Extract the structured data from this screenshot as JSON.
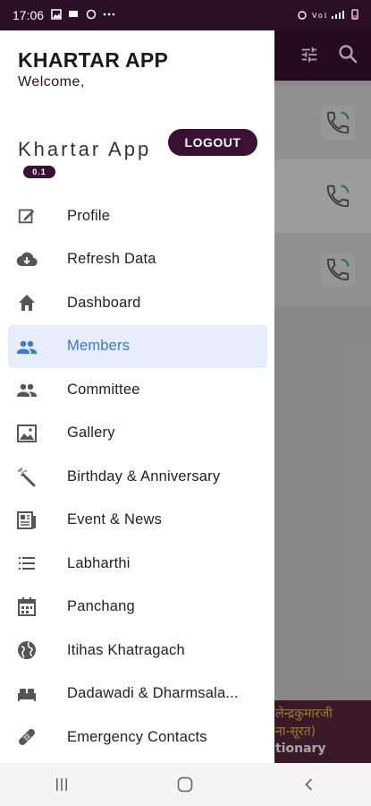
{
  "status_bar": {
    "time": "17:06",
    "left_icons": [
      "image-icon",
      "message-icon",
      "notification-icon",
      "more-dots-icon"
    ],
    "right_icons": [
      "alarm-icon",
      "volte-icon",
      "signal-icon",
      "battery-icon"
    ],
    "more": "···"
  },
  "drawer": {
    "app_title": "KHARTAR APP",
    "welcome": "Welcome,",
    "brand_name": "Khartar App",
    "logout_label": "LOGOUT",
    "version": "0.1",
    "menu": [
      {
        "label": "Profile",
        "icon": "edit-icon",
        "active": false
      },
      {
        "label": "Refresh Data",
        "icon": "cloud-download-icon",
        "active": false
      },
      {
        "label": "Dashboard",
        "icon": "home-icon",
        "active": false
      },
      {
        "label": "Members",
        "icon": "people-icon",
        "active": true
      },
      {
        "label": "Committee",
        "icon": "group-icon",
        "active": false
      },
      {
        "label": "Gallery",
        "icon": "gallery-icon",
        "active": false
      },
      {
        "label": "Birthday & Anniversary",
        "icon": "magic-wand-icon",
        "active": false
      },
      {
        "label": "Event & News",
        "icon": "news-icon",
        "active": false
      },
      {
        "label": "Labharthi",
        "icon": "list-icon",
        "active": false
      },
      {
        "label": "Panchang",
        "icon": "calendar-icon",
        "active": false
      },
      {
        "label": "Itihas Khatragach",
        "icon": "globe-icon",
        "active": false
      },
      {
        "label": "Dadawadi & Dharmsala...",
        "icon": "bed-icon",
        "active": false
      },
      {
        "label": "Emergency Contacts",
        "icon": "bandage-icon",
        "active": false
      }
    ]
  },
  "background": {
    "appbar_icons": [
      "tune-icon",
      "search-icon"
    ],
    "banner_line1": "लेन्द्रकुमारजी",
    "banner_line2": "ना-सूरत)",
    "banner_line3": "tionary"
  },
  "nav_bar": {
    "buttons": [
      "recent-apps-icon",
      "home-circle-icon",
      "back-icon"
    ]
  },
  "colors": {
    "primary": "#3a1034",
    "active_text": "#3c78d8",
    "active_bg": "#e7edfb"
  }
}
